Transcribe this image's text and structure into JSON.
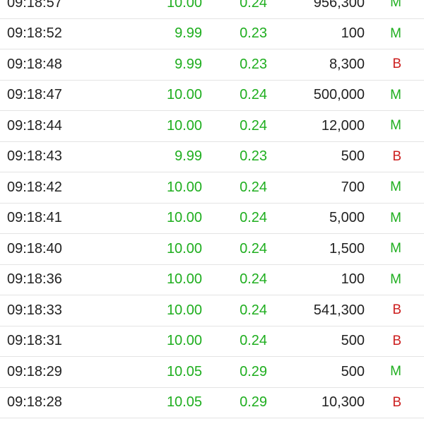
{
  "colors": {
    "up": "#1fae1f",
    "down": "#cc1e1e",
    "text": "#222222",
    "divider": "#e4e4e4"
  },
  "trades": [
    {
      "time": "09:18:57",
      "price": "10.00",
      "change": "0.24",
      "volume": "956,300",
      "side": "M"
    },
    {
      "time": "09:18:52",
      "price": "9.99",
      "change": "0.23",
      "volume": "100",
      "side": "M"
    },
    {
      "time": "09:18:48",
      "price": "9.99",
      "change": "0.23",
      "volume": "8,300",
      "side": "B"
    },
    {
      "time": "09:18:47",
      "price": "10.00",
      "change": "0.24",
      "volume": "500,000",
      "side": "M"
    },
    {
      "time": "09:18:44",
      "price": "10.00",
      "change": "0.24",
      "volume": "12,000",
      "side": "M"
    },
    {
      "time": "09:18:43",
      "price": "9.99",
      "change": "0.23",
      "volume": "500",
      "side": "B"
    },
    {
      "time": "09:18:42",
      "price": "10.00",
      "change": "0.24",
      "volume": "700",
      "side": "M"
    },
    {
      "time": "09:18:41",
      "price": "10.00",
      "change": "0.24",
      "volume": "5,000",
      "side": "M"
    },
    {
      "time": "09:18:40",
      "price": "10.00",
      "change": "0.24",
      "volume": "1,500",
      "side": "M"
    },
    {
      "time": "09:18:36",
      "price": "10.00",
      "change": "0.24",
      "volume": "100",
      "side": "M"
    },
    {
      "time": "09:18:33",
      "price": "10.00",
      "change": "0.24",
      "volume": "541,300",
      "side": "B"
    },
    {
      "time": "09:18:31",
      "price": "10.00",
      "change": "0.24",
      "volume": "500",
      "side": "B"
    },
    {
      "time": "09:18:29",
      "price": "10.05",
      "change": "0.29",
      "volume": "500",
      "side": "M"
    },
    {
      "time": "09:18:28",
      "price": "10.05",
      "change": "0.29",
      "volume": "10,300",
      "side": "B"
    }
  ]
}
